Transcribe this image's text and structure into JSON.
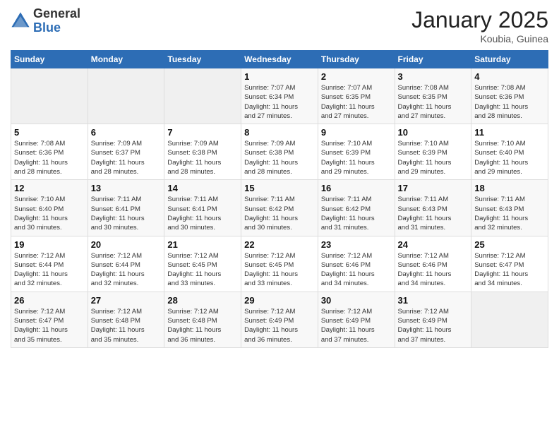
{
  "header": {
    "logo_general": "General",
    "logo_blue": "Blue",
    "month": "January 2025",
    "location": "Koubia, Guinea"
  },
  "days_of_week": [
    "Sunday",
    "Monday",
    "Tuesday",
    "Wednesday",
    "Thursday",
    "Friday",
    "Saturday"
  ],
  "weeks": [
    [
      {
        "day": "",
        "info": ""
      },
      {
        "day": "",
        "info": ""
      },
      {
        "day": "",
        "info": ""
      },
      {
        "day": "1",
        "info": "Sunrise: 7:07 AM\nSunset: 6:34 PM\nDaylight: 11 hours\nand 27 minutes."
      },
      {
        "day": "2",
        "info": "Sunrise: 7:07 AM\nSunset: 6:35 PM\nDaylight: 11 hours\nand 27 minutes."
      },
      {
        "day": "3",
        "info": "Sunrise: 7:08 AM\nSunset: 6:35 PM\nDaylight: 11 hours\nand 27 minutes."
      },
      {
        "day": "4",
        "info": "Sunrise: 7:08 AM\nSunset: 6:36 PM\nDaylight: 11 hours\nand 28 minutes."
      }
    ],
    [
      {
        "day": "5",
        "info": "Sunrise: 7:08 AM\nSunset: 6:36 PM\nDaylight: 11 hours\nand 28 minutes."
      },
      {
        "day": "6",
        "info": "Sunrise: 7:09 AM\nSunset: 6:37 PM\nDaylight: 11 hours\nand 28 minutes."
      },
      {
        "day": "7",
        "info": "Sunrise: 7:09 AM\nSunset: 6:38 PM\nDaylight: 11 hours\nand 28 minutes."
      },
      {
        "day": "8",
        "info": "Sunrise: 7:09 AM\nSunset: 6:38 PM\nDaylight: 11 hours\nand 28 minutes."
      },
      {
        "day": "9",
        "info": "Sunrise: 7:10 AM\nSunset: 6:39 PM\nDaylight: 11 hours\nand 29 minutes."
      },
      {
        "day": "10",
        "info": "Sunrise: 7:10 AM\nSunset: 6:39 PM\nDaylight: 11 hours\nand 29 minutes."
      },
      {
        "day": "11",
        "info": "Sunrise: 7:10 AM\nSunset: 6:40 PM\nDaylight: 11 hours\nand 29 minutes."
      }
    ],
    [
      {
        "day": "12",
        "info": "Sunrise: 7:10 AM\nSunset: 6:40 PM\nDaylight: 11 hours\nand 30 minutes."
      },
      {
        "day": "13",
        "info": "Sunrise: 7:11 AM\nSunset: 6:41 PM\nDaylight: 11 hours\nand 30 minutes."
      },
      {
        "day": "14",
        "info": "Sunrise: 7:11 AM\nSunset: 6:41 PM\nDaylight: 11 hours\nand 30 minutes."
      },
      {
        "day": "15",
        "info": "Sunrise: 7:11 AM\nSunset: 6:42 PM\nDaylight: 11 hours\nand 30 minutes."
      },
      {
        "day": "16",
        "info": "Sunrise: 7:11 AM\nSunset: 6:42 PM\nDaylight: 11 hours\nand 31 minutes."
      },
      {
        "day": "17",
        "info": "Sunrise: 7:11 AM\nSunset: 6:43 PM\nDaylight: 11 hours\nand 31 minutes."
      },
      {
        "day": "18",
        "info": "Sunrise: 7:11 AM\nSunset: 6:43 PM\nDaylight: 11 hours\nand 32 minutes."
      }
    ],
    [
      {
        "day": "19",
        "info": "Sunrise: 7:12 AM\nSunset: 6:44 PM\nDaylight: 11 hours\nand 32 minutes."
      },
      {
        "day": "20",
        "info": "Sunrise: 7:12 AM\nSunset: 6:44 PM\nDaylight: 11 hours\nand 32 minutes."
      },
      {
        "day": "21",
        "info": "Sunrise: 7:12 AM\nSunset: 6:45 PM\nDaylight: 11 hours\nand 33 minutes."
      },
      {
        "day": "22",
        "info": "Sunrise: 7:12 AM\nSunset: 6:45 PM\nDaylight: 11 hours\nand 33 minutes."
      },
      {
        "day": "23",
        "info": "Sunrise: 7:12 AM\nSunset: 6:46 PM\nDaylight: 11 hours\nand 34 minutes."
      },
      {
        "day": "24",
        "info": "Sunrise: 7:12 AM\nSunset: 6:46 PM\nDaylight: 11 hours\nand 34 minutes."
      },
      {
        "day": "25",
        "info": "Sunrise: 7:12 AM\nSunset: 6:47 PM\nDaylight: 11 hours\nand 34 minutes."
      }
    ],
    [
      {
        "day": "26",
        "info": "Sunrise: 7:12 AM\nSunset: 6:47 PM\nDaylight: 11 hours\nand 35 minutes."
      },
      {
        "day": "27",
        "info": "Sunrise: 7:12 AM\nSunset: 6:48 PM\nDaylight: 11 hours\nand 35 minutes."
      },
      {
        "day": "28",
        "info": "Sunrise: 7:12 AM\nSunset: 6:48 PM\nDaylight: 11 hours\nand 36 minutes."
      },
      {
        "day": "29",
        "info": "Sunrise: 7:12 AM\nSunset: 6:49 PM\nDaylight: 11 hours\nand 36 minutes."
      },
      {
        "day": "30",
        "info": "Sunrise: 7:12 AM\nSunset: 6:49 PM\nDaylight: 11 hours\nand 37 minutes."
      },
      {
        "day": "31",
        "info": "Sunrise: 7:12 AM\nSunset: 6:49 PM\nDaylight: 11 hours\nand 37 minutes."
      },
      {
        "day": "",
        "info": ""
      }
    ]
  ]
}
